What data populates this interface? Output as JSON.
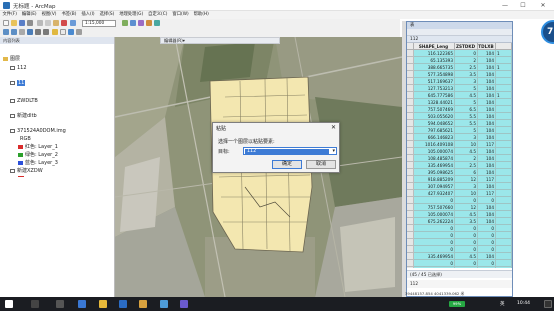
{
  "window": {
    "title": "无标题 - ArcMap",
    "controls": [
      "—",
      "☐",
      "✕"
    ]
  },
  "menubar": {
    "items": [
      "文件(F)",
      "编辑(E)",
      "视图(V)",
      "书签(B)",
      "插入(I)",
      "选择(S)",
      "地理处理(G)",
      "自定义(C)",
      "窗口(W)",
      "帮助(H)"
    ]
  },
  "toolbar": {
    "scale_value": "1:15,000",
    "map_tools_label": "编辑器(R)▾"
  },
  "toc": {
    "header": "内容列表",
    "root_label": "图层",
    "layers": [
      {
        "label": "112"
      },
      {
        "label": "11"
      },
      {
        "label": "ZWDLTB"
      },
      {
        "label": "新建dltb"
      },
      {
        "label": "371524A0DOM.img"
      },
      {
        "label": "RGB"
      },
      {
        "label": "红色: Layer_1",
        "color": "#d92b2b"
      },
      {
        "label": "绿色: Layer_2",
        "color": "#2ca02c"
      },
      {
        "label": "蓝色: Layer_3",
        "color": "#2b4fd9"
      },
      {
        "label": "新建XZDW"
      }
    ]
  },
  "dialog": {
    "title": "粘贴",
    "close": "✕",
    "prompt": "选择一个图层以粘贴要素:",
    "target_label": "目标:",
    "target_value": "112",
    "ok": "确定",
    "cancel": "取消"
  },
  "table": {
    "window_title": "表",
    "tab_label": "112",
    "columns": [
      "",
      "SHAPE_Leng",
      "ZSTDKD",
      "TDLXB",
      ""
    ],
    "rows": [
      [
        "",
        "116.122365",
        "0",
        "104",
        "1"
      ],
      [
        "",
        "65.135393",
        "2",
        "104",
        ""
      ],
      [
        "",
        "388.665735",
        "2.5",
        "104",
        "1"
      ],
      [
        "",
        "577.354898",
        "3.5",
        "104",
        ""
      ],
      [
        "",
        "517.169637",
        "3",
        "104",
        ""
      ],
      [
        "",
        "127.753213",
        "5",
        "104",
        ""
      ],
      [
        "",
        "645.777586",
        "4.5",
        "104",
        "1"
      ],
      [
        "",
        "1328.44021",
        "5",
        "104",
        ""
      ],
      [
        "",
        "757.507469",
        "6.5",
        "104",
        ""
      ],
      [
        "",
        "503.055620",
        "5.5",
        "104",
        ""
      ],
      [
        "",
        "594.048652",
        "5.5",
        "104",
        ""
      ],
      [
        "",
        "797.685621",
        "5",
        "104",
        ""
      ],
      [
        "",
        "666.146823",
        "3",
        "104",
        ""
      ],
      [
        "",
        "1016.409108",
        "10",
        "117",
        ""
      ],
      [
        "",
        "105.000074",
        "4.5",
        "104",
        ""
      ],
      [
        "",
        "108.485874",
        "2",
        "104",
        ""
      ],
      [
        "",
        "335.469954",
        "2.5",
        "104",
        ""
      ],
      [
        "",
        "395.098625",
        "6",
        "104",
        ""
      ],
      [
        "",
        "918.885209",
        "12",
        "117",
        ""
      ],
      [
        "",
        "307.094957",
        "3",
        "104",
        ""
      ],
      [
        "",
        "427.932407",
        "10",
        "117",
        ""
      ],
      [
        "",
        "0",
        "0",
        "0",
        ""
      ],
      [
        "",
        "757.507660",
        "12",
        "104",
        ""
      ],
      [
        "",
        "105.000074",
        "4.5",
        "104",
        ""
      ],
      [
        "",
        "675.262224",
        "3.5",
        "104",
        ""
      ],
      [
        "",
        "0",
        "0",
        "0",
        ""
      ],
      [
        "",
        "0",
        "0",
        "0",
        ""
      ],
      [
        "",
        "0",
        "0",
        "0",
        ""
      ],
      [
        "",
        "0",
        "0",
        "0",
        ""
      ],
      [
        "",
        "335.469954",
        "4.5",
        "104",
        ""
      ],
      [
        "",
        "0",
        "0",
        "0",
        ""
      ],
      [
        "",
        "0",
        "0",
        "0",
        ""
      ],
      [
        "",
        "105.000074",
        "4.5",
        "104",
        ""
      ]
    ],
    "record_status": "(45 / 45 已选择)",
    "status_tab": "112"
  },
  "status": {
    "coordinates": "39448157.854  4041339.062 米"
  },
  "taskbar": {
    "time": "10:44",
    "battery_label": "99%",
    "lang": "英",
    "badge": "7"
  }
}
